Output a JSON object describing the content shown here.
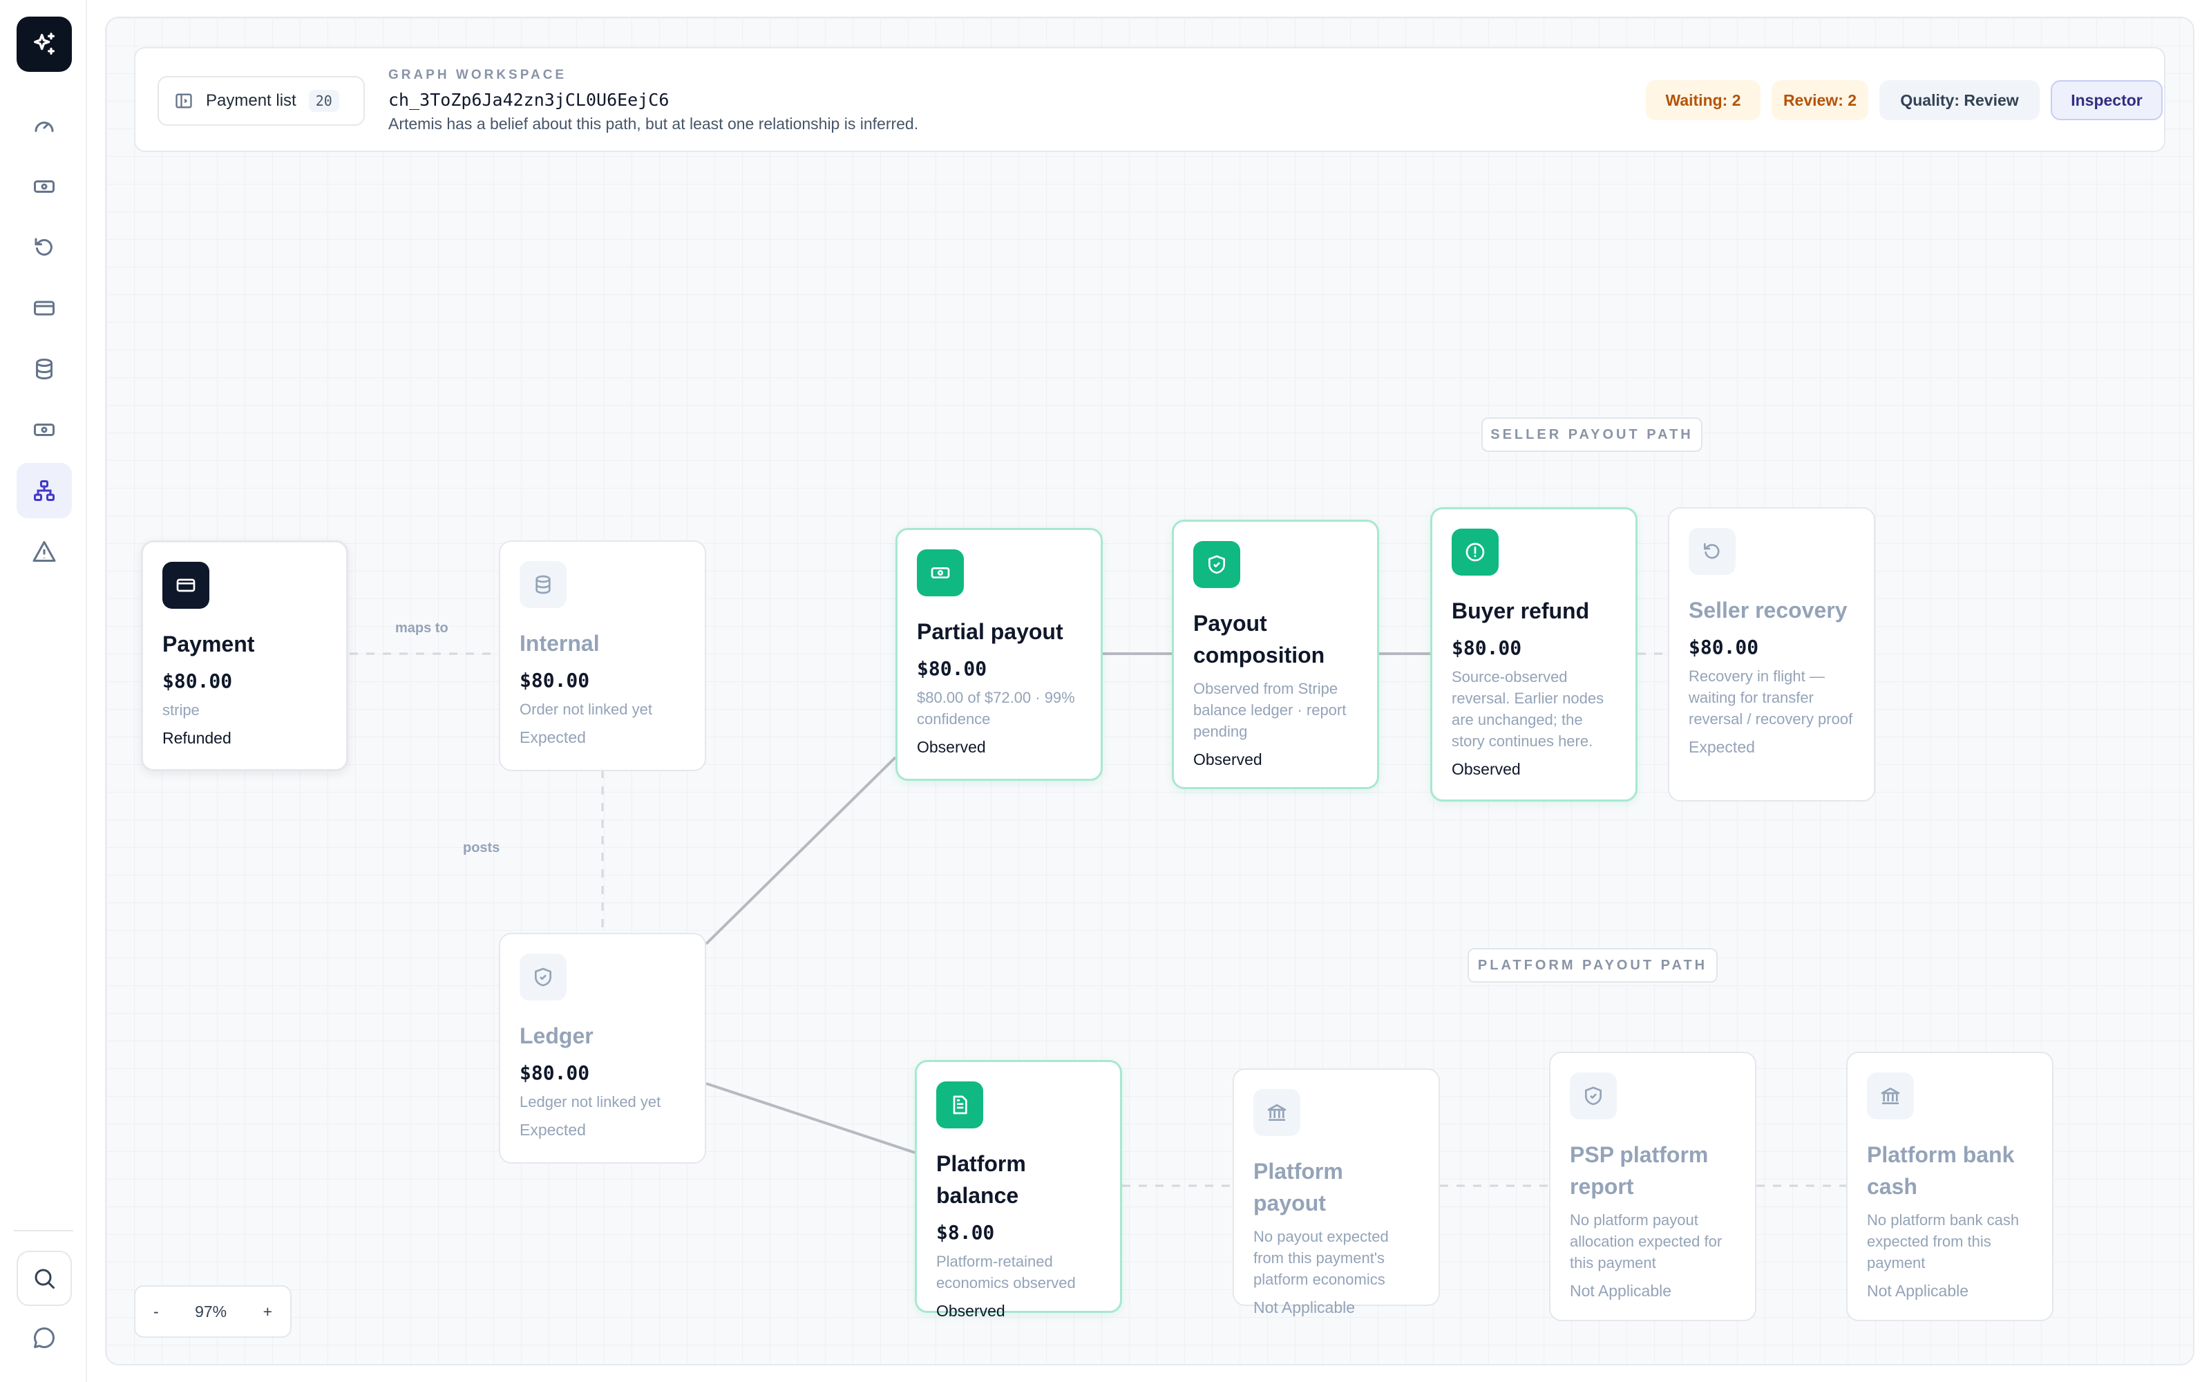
{
  "rail": {
    "logo": "sparkles-icon",
    "items": [
      {
        "icon": "gauge-icon",
        "label": "dashboard"
      },
      {
        "icon": "banknote-icon",
        "label": "payouts"
      },
      {
        "icon": "rotate-ccw-icon",
        "label": "refunds"
      },
      {
        "icon": "credit-card-icon",
        "label": "payments"
      },
      {
        "icon": "database-icon",
        "label": "ledger"
      },
      {
        "icon": "banknote-icon",
        "label": "balances"
      },
      {
        "icon": "network-icon",
        "label": "graph",
        "active": true
      },
      {
        "icon": "alert-triangle-icon",
        "label": "alerts"
      }
    ]
  },
  "header": {
    "payment_list_label": "Payment list",
    "payment_list_count": "20",
    "eyebrow": "GRAPH WORKSPACE",
    "charge_id": "ch_3ToZp6Ja42zn3jCL0U6EejC6",
    "description": "Artemis has a belief about this path, but at least one relationship is inferred.",
    "badges": {
      "waiting": "Waiting: 2",
      "review": "Review: 2",
      "quality": "Quality: Review",
      "inspector": "Inspector"
    }
  },
  "path_labels": {
    "seller": "SELLER PAYOUT PATH",
    "platform": "PLATFORM PAYOUT PATH"
  },
  "edge_labels": {
    "maps_to": "maps to",
    "posts": "posts"
  },
  "nodes": {
    "payment": {
      "title": "Payment",
      "amount": "$80.00",
      "desc": "stripe",
      "status": "Refunded"
    },
    "internal": {
      "title": "Internal",
      "amount": "$80.00",
      "desc": "Order not linked yet",
      "status": "Expected"
    },
    "ledger": {
      "title": "Ledger",
      "amount": "$80.00",
      "desc": "Ledger not linked yet",
      "status": "Expected"
    },
    "partial_payout": {
      "title": "Partial payout",
      "amount": "$80.00",
      "desc": "$80.00 of $72.00 · 99% confidence",
      "status": "Observed"
    },
    "payout_composition": {
      "title": "Payout composition",
      "desc": "Observed from Stripe balance ledger · report pending",
      "status": "Observed"
    },
    "buyer_refund": {
      "title": "Buyer refund",
      "amount": "$80.00",
      "desc": "Source-observed reversal. Earlier nodes are unchanged; the story continues here.",
      "status": "Observed"
    },
    "seller_recovery": {
      "title": "Seller recovery",
      "amount": "$80.00",
      "desc": "Recovery in flight — waiting for transfer reversal / recovery proof",
      "status": "Expected"
    },
    "platform_balance": {
      "title": "Platform balance",
      "amount": "$8.00",
      "desc": "Platform-retained economics observed",
      "status": "Observed"
    },
    "platform_payout": {
      "title": "Platform payout",
      "desc": "No payout expected from this payment's platform economics",
      "status": "Not Applicable"
    },
    "psp_platform_report": {
      "title": "PSP platform report",
      "desc": "No platform payout allocation expected for this payment",
      "status": "Not Applicable"
    },
    "platform_bank_cash": {
      "title": "Platform bank cash",
      "desc": "No platform bank cash expected from this payment",
      "status": "Not Applicable"
    }
  },
  "zoom": {
    "minus": "-",
    "level": "97%",
    "plus": "+"
  },
  "colors": {
    "observed": "#10b981",
    "accent": "#312e81",
    "warning": "#b45309"
  }
}
